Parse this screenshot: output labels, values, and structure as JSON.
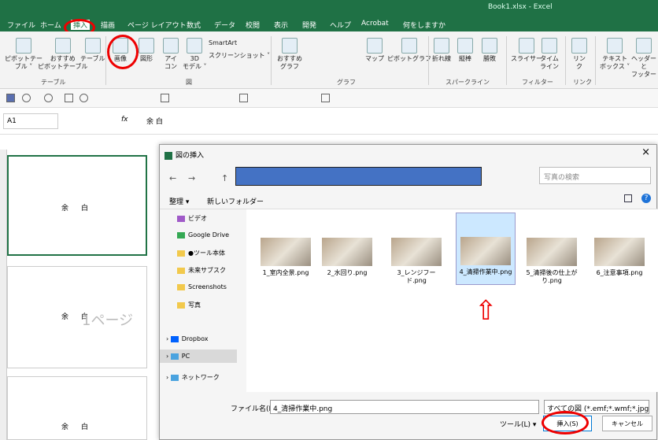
{
  "app": {
    "book_title": "Book1.xlsx  -  Excel"
  },
  "tabs": [
    "ファイル",
    "ホーム",
    "挿入",
    "描画",
    "ページ レイアウト",
    "数式",
    "データ",
    "校閲",
    "表示",
    "開発",
    "ヘルプ",
    "Acrobat",
    "何をしますか"
  ],
  "ribbon": {
    "pivot": "ピボットテー\nブル ˅",
    "rec_pivot": "おすすめ\nピボットテーブル",
    "table": "テーブル",
    "group_table": "テーブル",
    "image": "画像",
    "shape": "図形",
    "icon": "アイ\nコン",
    "model3d": "3D\nモデル ˅",
    "smartart": "SmartArt",
    "screenshot": "スクリーンショット ˅",
    "group_fig": "図",
    "rec_chart": "おすすめ\nグラフ",
    "map": "マップ",
    "pivot_chart": "ピボットグラフ",
    "group_chart": "グラフ",
    "line": "折れ線",
    "column": "縦棒",
    "winloss": "勝敗",
    "group_spark": "スパークライン",
    "slicer": "スライサー",
    "timeline": "タイム\nライン",
    "group_filter": "フィルター",
    "link": "リン\nク",
    "group_link": "リンク",
    "textbox": "テキスト\nボックス ˅",
    "header": "ヘッダーと\nフッター"
  },
  "formula": {
    "namebox": "A1",
    "fx": "fx",
    "content": "余      白"
  },
  "sheet": {
    "cell_text": "余白",
    "page_label": "1ページ"
  },
  "dialog": {
    "title": "図の挿入",
    "search_placeholder": "写真の検索",
    "organize": "整理 ▾",
    "new_folder": "新しいフォルダー",
    "nav": [
      "ビデオ",
      "Google Drive",
      "●ツール本体",
      "未来サブスク",
      "Screenshots",
      "写真",
      "Dropbox",
      "PC",
      "ネットワーク"
    ],
    "files": [
      "1_室内全景.png",
      "2_水回り.png",
      "3_レンジフード.png",
      "4_清掃作業中.png",
      "5_清掃後の仕上がり.png",
      "6_注意事項.png"
    ],
    "filename_label": "ファイル名(N):",
    "filename_value": "4_清掃作業中.png",
    "filetype": "すべての図 (*.emf;*.wmf;*.jpg;*.j",
    "tools": "ツール(L)  ▾",
    "insert": "挿入(S)",
    "cancel": "キャンセル"
  },
  "colors": {
    "excel_green": "#1f7145",
    "highlight_red": "#e00000",
    "address_blue": "#4472c4"
  }
}
